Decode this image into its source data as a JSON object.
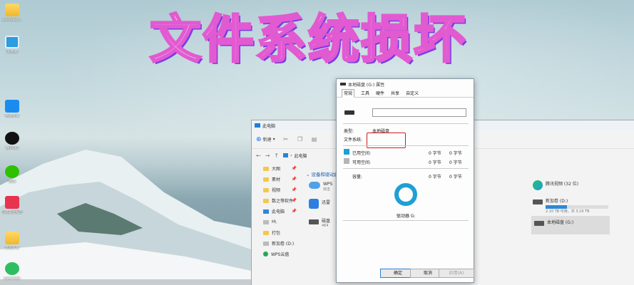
{
  "headline": "文件系统损坏",
  "desktop": {
    "icons": [
      {
        "label": "Administr...",
        "icon": "folder-icon"
      },
      {
        "label": "此电脑",
        "icon": "computer-icon"
      },
      {
        "label": "电脑管家",
        "icon": "app-icon"
      },
      {
        "label": "腾讯QQ",
        "icon": "qq-icon"
      },
      {
        "label": "微信",
        "icon": "wechat-icon"
      },
      {
        "label": "向日葵远程控制",
        "icon": "sunlogin-icon"
      },
      {
        "label": "数据恢复",
        "icon": "folder-icon"
      },
      {
        "label": "Evernote",
        "icon": "evernote-icon"
      }
    ]
  },
  "explorer": {
    "title": "此电脑",
    "new_label": "新建",
    "breadcrumb": "此电脑",
    "nav": [
      {
        "label": "大图",
        "icon": "folder"
      },
      {
        "label": "素材",
        "icon": "folder"
      },
      {
        "label": "视频",
        "icon": "folder"
      },
      {
        "label": "数之等软件",
        "icon": "folder"
      },
      {
        "label": "此电脑",
        "icon": "pc"
      },
      {
        "label": "H\\",
        "icon": "drive"
      },
      {
        "label": "打包",
        "icon": "folder"
      },
      {
        "label": "新加卷 (D:)",
        "icon": "drive"
      },
      {
        "label": "WPS云盘",
        "icon": "cloud"
      }
    ],
    "group_header": "设备和驱动器",
    "items": {
      "wps": {
        "name": "WPS",
        "sub": "双击"
      },
      "third": {
        "name": "迅雷"
      },
      "local": {
        "name": "磁盘",
        "sub": "464"
      },
      "tencent": {
        "name": "腾讯视频 (32 位)"
      },
      "d_drive": {
        "name": "新加卷 (D:)",
        "sub": "2.10 TB 可用，共 3.16 TB",
        "used_fraction": 0.34
      },
      "g_drive": {
        "name": "本地磁盘 (G:)"
      }
    }
  },
  "dialog": {
    "title": "本地磁盘 (G:) 属性",
    "tabs": [
      "常规",
      "工具",
      "硬件",
      "共享",
      "自定义"
    ],
    "active_tab": "常规",
    "name_value": "",
    "type_label": "类型:",
    "type_value": "本地磁盘",
    "fs_label": "文件系统:",
    "fs_value": "",
    "used_label": "已用空间:",
    "used_value": "0 字节",
    "used_value2": "0 字节",
    "free_label": "可用空间:",
    "free_value": "0 字节",
    "free_value2": "0 字节",
    "capacity_label": "容量:",
    "capacity_value": "0 字节",
    "capacity_value2": "0 字节",
    "drive_label": "驱动器 G:",
    "buttons": {
      "ok": "确定",
      "cancel": "取消",
      "apply": "应用(A)"
    },
    "colors": {
      "used": "#1f9fd6",
      "free": "#b5b5b5",
      "ring": "#1f9fd6",
      "highlight_box": "#c81e1e"
    }
  }
}
